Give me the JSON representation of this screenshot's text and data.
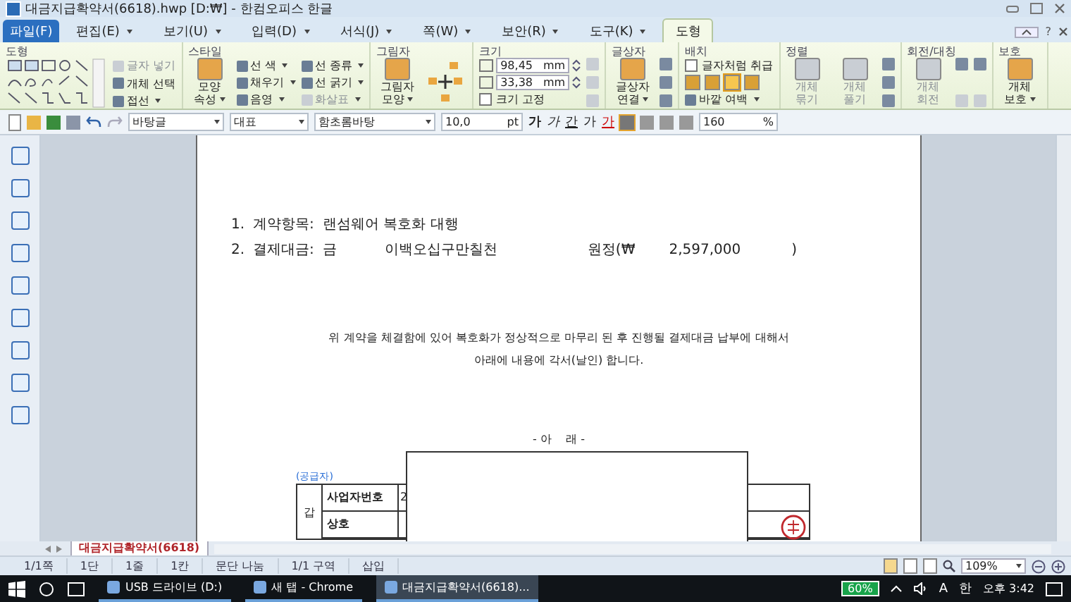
{
  "window": {
    "title": "대금지급확약서(6618).hwp [D:₩] - 한컴오피스 한글"
  },
  "menu_tabs": [
    {
      "label": "파일(F)",
      "kind": "file",
      "selected": false
    },
    {
      "label": "편집(E)",
      "kind": "menu",
      "selected": false
    },
    {
      "label": "보기(U)",
      "kind": "menu",
      "selected": false
    },
    {
      "label": "입력(D)",
      "kind": "menu",
      "selected": false
    },
    {
      "label": "서식(J)",
      "kind": "menu",
      "selected": false
    },
    {
      "label": "쪽(W)",
      "kind": "menu",
      "selected": false
    },
    {
      "label": "보안(R)",
      "kind": "menu",
      "selected": false
    },
    {
      "label": "도구(K)",
      "kind": "menu",
      "selected": false
    },
    {
      "label": "도형",
      "kind": "context",
      "selected": true
    }
  ],
  "ribbon": [
    {
      "title": "도형",
      "columns": [
        [
          {
            "kind": "gallery"
          }
        ],
        [
          {
            "kind": "small",
            "label": "글자 넣기",
            "disabled": true,
            "has_menu": false
          },
          {
            "kind": "small",
            "label": "개체 선택",
            "disabled": false,
            "has_menu": false
          },
          {
            "kind": "small",
            "label": "접선",
            "disabled": false,
            "has_menu": true
          }
        ]
      ]
    },
    {
      "title": "스타일",
      "columns": [
        [
          {
            "kind": "big",
            "label": "모양 속성",
            "disabled": false,
            "has_menu": true
          }
        ],
        [
          {
            "kind": "small",
            "label": "선 색",
            "disabled": false,
            "has_menu": true
          },
          {
            "kind": "small",
            "label": "채우기",
            "disabled": false,
            "has_menu": true
          },
          {
            "kind": "small",
            "label": "음영",
            "disabled": false,
            "has_menu": true
          }
        ],
        [
          {
            "kind": "small",
            "label": "선 종류",
            "disabled": false,
            "has_menu": true
          },
          {
            "kind": "small",
            "label": "선 굵기",
            "disabled": false,
            "has_menu": true
          },
          {
            "kind": "small",
            "label": "화살표",
            "disabled": true,
            "has_menu": true
          }
        ]
      ]
    },
    {
      "title": "그림자",
      "columns": [
        [
          {
            "kind": "big",
            "label": "그림자 모양",
            "disabled": false,
            "has_menu": true
          }
        ],
        [
          {
            "kind": "arrows"
          }
        ]
      ]
    },
    {
      "title": "크기",
      "columns": [
        [
          {
            "kind": "field",
            "value": "98,45",
            "unit": "mm"
          },
          {
            "kind": "field",
            "value": "33,38",
            "unit": "mm"
          },
          {
            "kind": "check",
            "label": "크기 고정",
            "checked": false
          }
        ],
        [
          {
            "kind": "icon",
            "disabled": true
          },
          {
            "kind": "icon",
            "disabled": true
          },
          {
            "kind": "icon",
            "disabled": true
          }
        ]
      ]
    },
    {
      "title": "글상자",
      "columns": [
        [
          {
            "kind": "big",
            "label": "글상자 연결",
            "disabled": false,
            "has_menu": true
          }
        ],
        [
          {
            "kind": "icon",
            "disabled": false
          },
          {
            "kind": "icon",
            "disabled": false
          },
          {
            "kind": "icon",
            "disabled": false
          }
        ]
      ]
    },
    {
      "title": "배치",
      "columns": [
        [
          {
            "kind": "check",
            "label": "글자처럼 취급",
            "checked": false
          },
          {
            "kind": "wraps",
            "options": [
              {
                "selected": false
              },
              {
                "selected": false
              },
              {
                "selected": true
              },
              {
                "selected": false
              }
            ]
          },
          {
            "kind": "small",
            "label": "바깥 여백",
            "disabled": false,
            "has_menu": true
          }
        ]
      ]
    },
    {
      "title": "정렬",
      "columns": [
        [
          {
            "kind": "big",
            "label": "개체 묶기",
            "disabled": true,
            "has_menu": false
          }
        ],
        [
          {
            "kind": "big",
            "label": "개체 풀기",
            "disabled": true,
            "has_menu": false
          }
        ],
        [
          {
            "kind": "icon",
            "disabled": false
          },
          {
            "kind": "icon",
            "disabled": false
          },
          {
            "kind": "icon",
            "disabled": false
          }
        ]
      ]
    },
    {
      "title": "회전/대칭",
      "columns": [
        [
          {
            "kind": "big",
            "label": "개체 회전",
            "disabled": true,
            "has_menu": false
          }
        ],
        [
          {
            "kind": "icon",
            "disabled": false
          },
          {
            "kind": "icon",
            "disabled": true
          }
        ],
        [
          {
            "kind": "icon",
            "disabled": false
          },
          {
            "kind": "icon",
            "disabled": true
          }
        ]
      ]
    },
    {
      "title": "보호",
      "columns": [
        [
          {
            "kind": "big",
            "label": "개체 보호",
            "disabled": false,
            "has_menu": true
          }
        ]
      ]
    }
  ],
  "toolbar": {
    "style": "바탕글",
    "outline": "대표",
    "font": "함초롬바탕",
    "size": "10,0",
    "size_unit": "pt",
    "char_format": [
      {
        "label": "가",
        "kind": "bold"
      },
      {
        "label": "가",
        "kind": "italic"
      },
      {
        "label": "간",
        "kind": "underline"
      },
      {
        "label": "가",
        "kind": "outline"
      },
      {
        "label": "가",
        "kind": "color"
      }
    ],
    "align": [
      {
        "selected": true
      },
      {
        "selected": false
      },
      {
        "selected": false
      },
      {
        "selected": false
      }
    ],
    "line_spacing": "160",
    "line_spacing_unit": "%"
  },
  "document": {
    "item_1": {
      "number": "1.",
      "label": "계약항목:",
      "value": "랜섬웨어 복호화 대행"
    },
    "item_2": {
      "number": "2.",
      "label": "결제대금:",
      "prefix": "금",
      "amount_words": "이백오십구만칠천",
      "amount_prefix": "원정(₩",
      "amount": "2,597,000",
      "close": ")"
    },
    "paragraph": [
      "위 계약을 체결함에 있어 복호화가 정상적으로 마무리 된 후 진행될 결제대금 납부에 대해서",
      "아래에 내용에 각서(날인) 합니다."
    ],
    "heading": "- 아    래 -",
    "table_caption": "(공급자)",
    "table": {
      "side": "갑",
      "rows": [
        {
          "label": "사업자번호",
          "value": "2"
        },
        {
          "label": "상호"
        }
      ]
    }
  },
  "help_label": "?",
  "doc_tab": "대금지급확약서(6618)",
  "status_bar": [
    "1/1쪽",
    "1단",
    "1줄",
    "1칸",
    "문단 나눔",
    "1/1 구역",
    "삽입"
  ],
  "zoom": "109%",
  "taskbar": {
    "apps": [
      {
        "label": "USB 드라이브 (D:)",
        "selected": false
      },
      {
        "label": "새 탭 - Chrome",
        "selected": false
      },
      {
        "label": "대금지급확약서(6618)...",
        "selected": true
      }
    ],
    "battery": "60%",
    "ime_mode": "A",
    "ime_lang": "한",
    "clock": "오후 3:42"
  }
}
